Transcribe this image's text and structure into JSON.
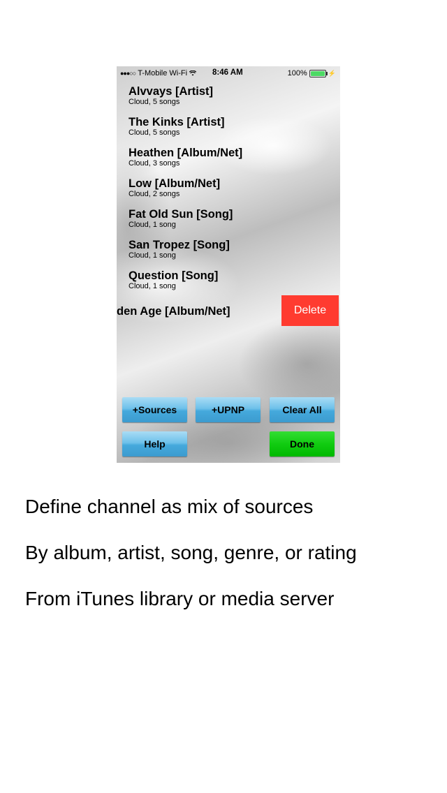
{
  "status_bar": {
    "carrier": "T-Mobile Wi-Fi",
    "time": "8:46 AM",
    "battery": "100%"
  },
  "sources": [
    {
      "title": "Alvvays [Artist]",
      "subtitle": "Cloud, 5 songs"
    },
    {
      "title": "The Kinks [Artist]",
      "subtitle": "Cloud, 5 songs"
    },
    {
      "title": "Heathen [Album/Net]",
      "subtitle": "Cloud, 3 songs"
    },
    {
      "title": "Low [Album/Net]",
      "subtitle": "Cloud, 2 songs"
    },
    {
      "title": "Fat Old Sun [Song]",
      "subtitle": "Cloud, 1 song"
    },
    {
      "title": "San Tropez [Song]",
      "subtitle": "Cloud, 1 song"
    },
    {
      "title": "Question [Song]",
      "subtitle": "Cloud, 1 song"
    },
    {
      "title": "den Age [Album/Net]",
      "subtitle": ""
    }
  ],
  "delete_label": "Delete",
  "buttons": {
    "sources": "+Sources",
    "upnp": "+UPNP",
    "clear_all": "Clear All",
    "help": "Help",
    "done": "Done"
  },
  "captions": [
    "Define channel as mix of sources",
    "By album, artist, song, genre, or rating",
    "From iTunes library or media server"
  ]
}
